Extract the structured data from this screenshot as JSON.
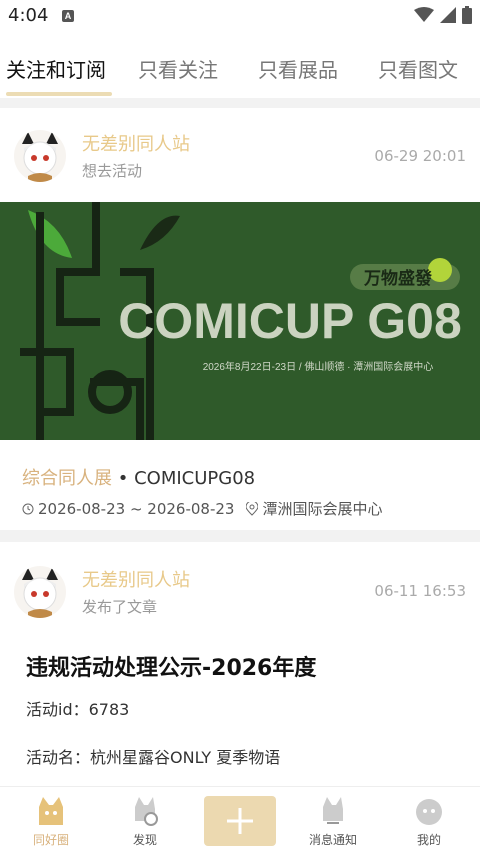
{
  "status_bar": {
    "time": "4:04",
    "notif": "A"
  },
  "tabs": [
    {
      "label": "关注和订阅",
      "active": true
    },
    {
      "label": "只看关注"
    },
    {
      "label": "只看展品"
    },
    {
      "label": "只看图文"
    }
  ],
  "feed": [
    {
      "user_name": "无差别同人站",
      "action": "想去活动",
      "time": "06-29 20:01",
      "banner": {
        "tagline": "万物盛發",
        "title": "COMICUP G08",
        "subtitle": "2026年8月22日-23日 / 佛山顺德 · 潭洲国际会展中心"
      },
      "category": "综合同人展",
      "separator": "•",
      "event_name": "COMICUPG08",
      "date_range": "2026-08-23 ~ 2026-08-23",
      "venue": "潭洲国际会展中心"
    },
    {
      "user_name": "无差别同人站",
      "action": "发布了文章",
      "time": "06-11 16:53",
      "title": "违规活动处理公示-2026年度",
      "lines": [
        "活动id：6783",
        "活动名：杭州星露谷ONLY 夏季物语"
      ]
    }
  ],
  "bottom_nav": [
    {
      "label": "同好圈",
      "active": true
    },
    {
      "label": "发现"
    },
    {
      "label": "+"
    },
    {
      "label": "消息通知"
    },
    {
      "label": "我的"
    }
  ],
  "colors": {
    "accent": "#e8c98a",
    "banner_bg": "#2f5a2a"
  }
}
